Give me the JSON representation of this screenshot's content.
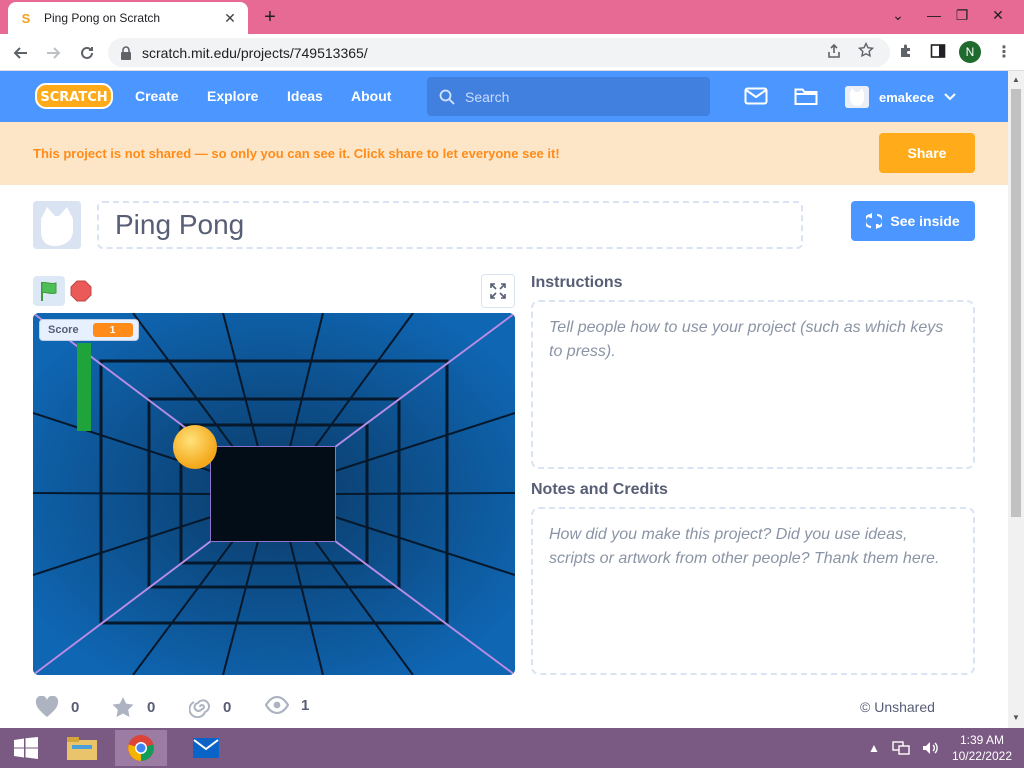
{
  "browser": {
    "tab_title": "Ping Pong on Scratch",
    "url": "scratch.mit.edu/projects/749513365/",
    "profile_initial": "N"
  },
  "nav": {
    "create": "Create",
    "explore": "Explore",
    "ideas": "Ideas",
    "about": "About",
    "search_placeholder": "Search",
    "username": "emakece"
  },
  "banner": {
    "message": "This project is not shared — so only you can see it. Click share to let everyone see it!",
    "share_label": "Share"
  },
  "project": {
    "title": "Ping Pong",
    "see_inside_label": "See inside"
  },
  "stage": {
    "score_label": "Score",
    "score_value": "1"
  },
  "instructions": {
    "heading": "Instructions",
    "placeholder": "Tell people how to use your project (such as which keys to press)."
  },
  "notes": {
    "heading": "Notes and Credits",
    "placeholder": "How did you make this project? Did you use ideas, scripts or artwork from other people? Thank them here."
  },
  "stats": {
    "loves": "0",
    "favorites": "0",
    "remixes": "0",
    "views": "1",
    "share_status": "© Unshared"
  },
  "taskbar": {
    "time": "1:39 AM",
    "date": "10/22/2022"
  },
  "colors": {
    "scratch_blue": "#4c97ff",
    "share_orange": "#ffab1a",
    "banner_bg": "#fde6c7",
    "banner_text": "#ff8c1a"
  }
}
